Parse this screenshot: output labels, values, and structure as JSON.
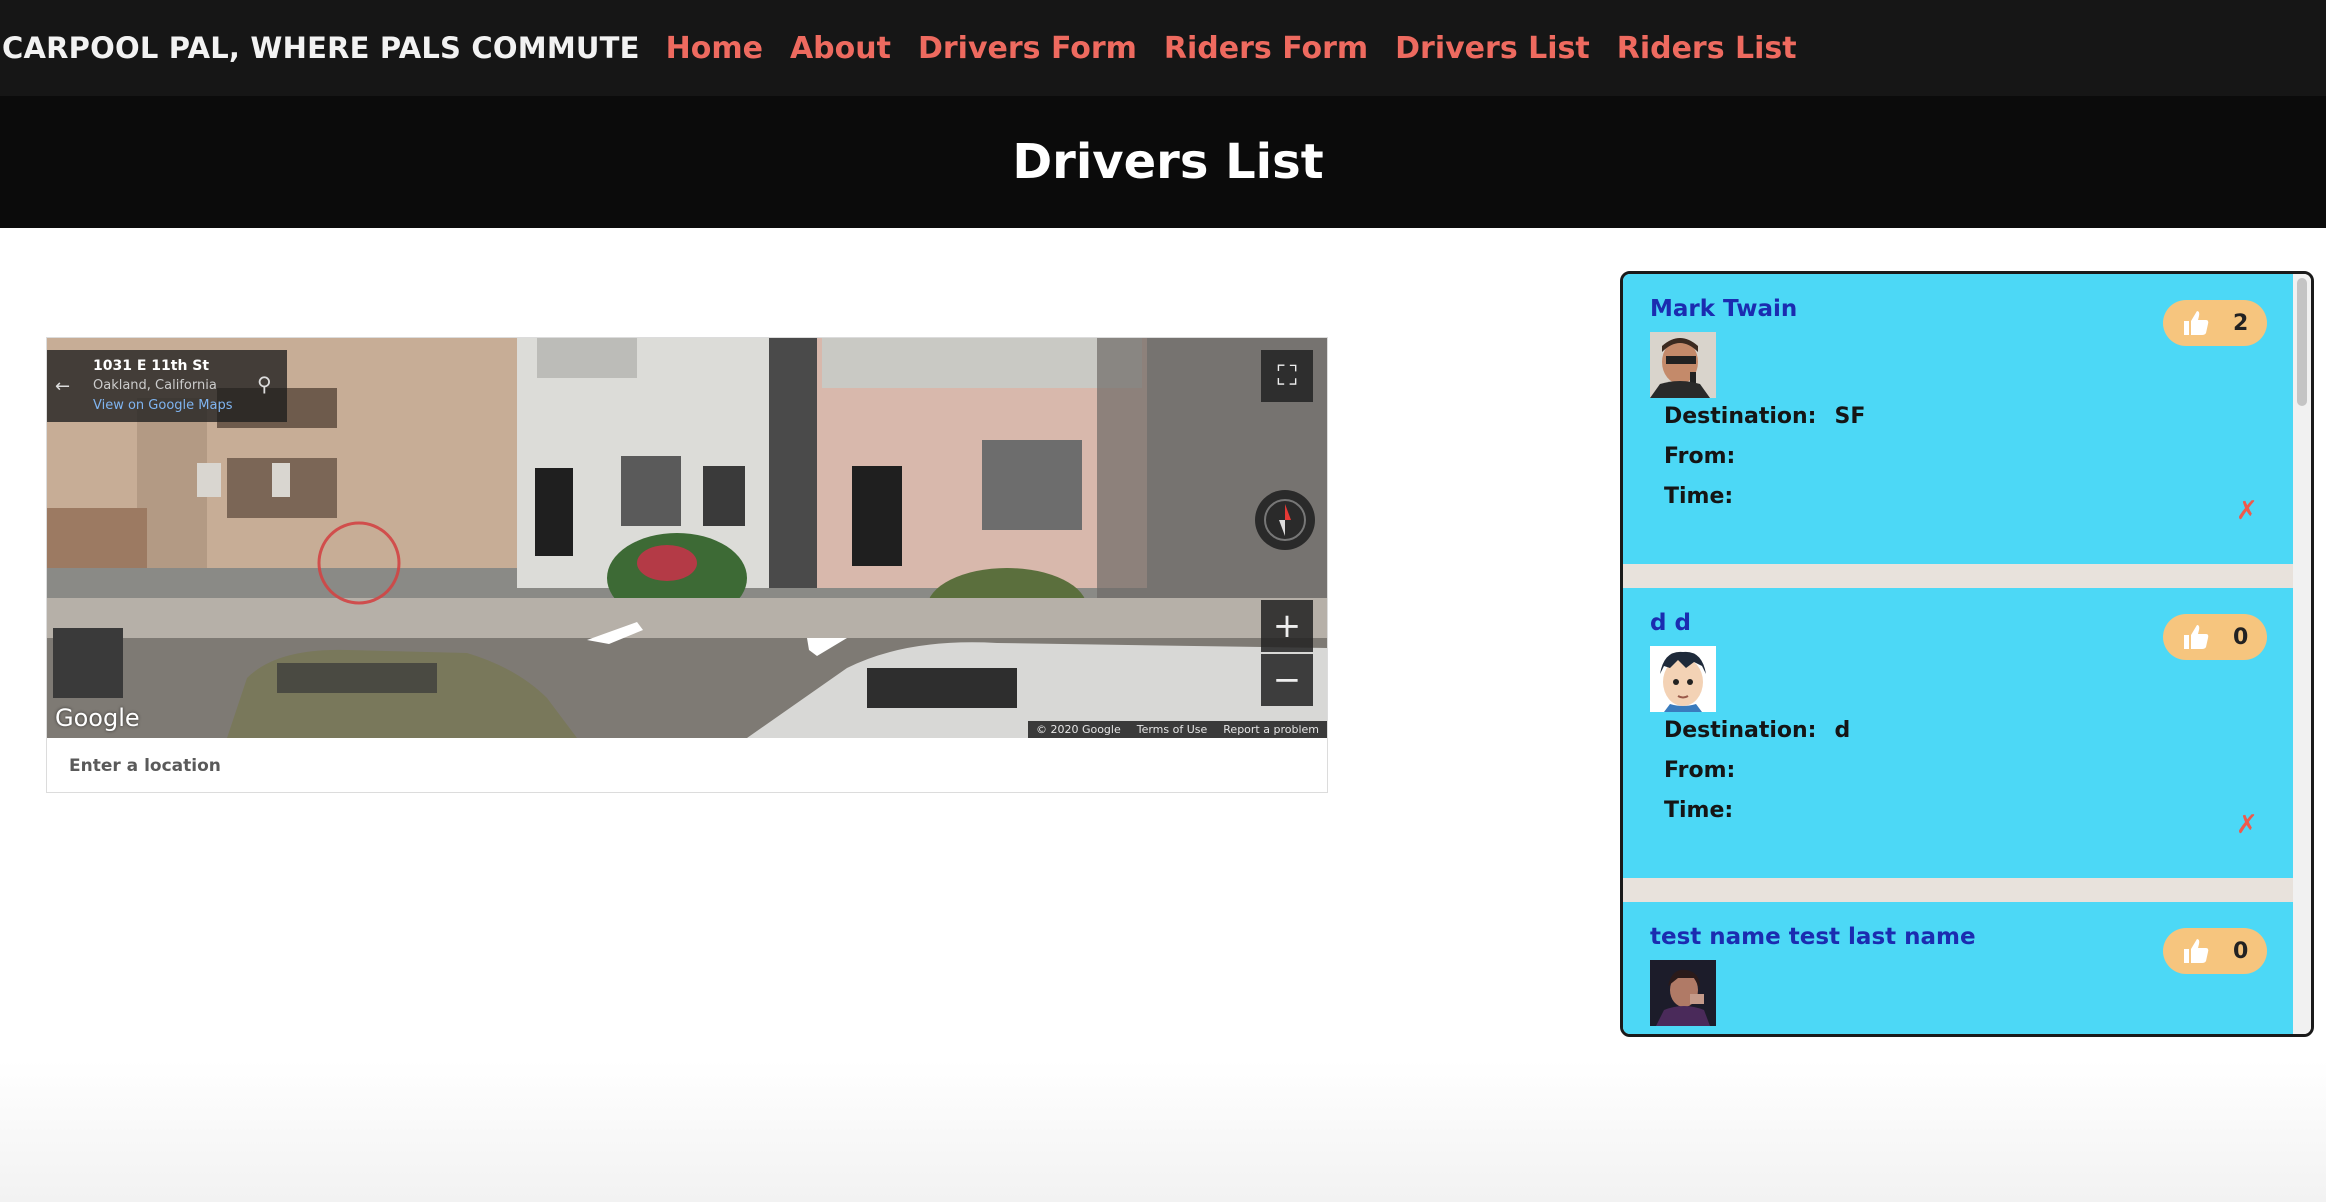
{
  "navbar": {
    "brand": "CARPOOL PAL, WHERE PALS COMMUTE",
    "links": [
      "Home",
      "About",
      "Drivers Form",
      "Riders Form",
      "Drivers List",
      "Riders List"
    ]
  },
  "header": {
    "title": "Drivers List"
  },
  "map": {
    "address_street": "1031 E 11th St",
    "address_city": "Oakland, California",
    "view_link": "View on Google Maps",
    "logo": "Google",
    "copyright": "© 2020 Google",
    "terms": "Terms of Use",
    "report": "Report a problem",
    "search_placeholder": "Enter a location",
    "icons": {
      "back": "back-arrow-icon",
      "pin": "location-pin-icon",
      "fullscreen": "fullscreen-icon",
      "compass": "compass-icon",
      "zoom_in": "plus-icon",
      "zoom_out": "minus-icon"
    }
  },
  "drivers": [
    {
      "name": "Mark Twain",
      "likes": "2",
      "destination_label": "Destination:",
      "destination": "SF",
      "from_label": "From:",
      "from": "",
      "time_label": "Time:",
      "time": "",
      "delete": "✗"
    },
    {
      "name": "d d",
      "likes": "0",
      "destination_label": "Destination:",
      "destination": "d",
      "from_label": "From:",
      "from": "",
      "time_label": "Time:",
      "time": "",
      "delete": "✗"
    },
    {
      "name": "test name test last name",
      "likes": "0"
    }
  ],
  "colors": {
    "navbar_bg": "#161616",
    "nav_link": "#ee6a5f",
    "header_bg": "#0b0b0b",
    "card_bg": "#4cd8f6",
    "driver_name": "#1b2cb0",
    "like_pill": "#f6c57e",
    "delete": "#ee5a4c"
  }
}
